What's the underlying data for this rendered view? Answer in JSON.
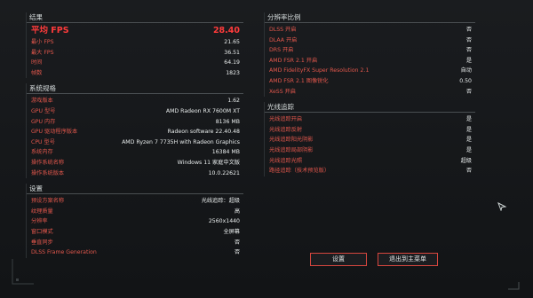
{
  "results": {
    "title": "结果",
    "avg_fps_label": "平均 FPS",
    "avg_fps": "28.40",
    "rows": [
      {
        "label": "最小 FPS",
        "value": "21.65"
      },
      {
        "label": "最大 FPS",
        "value": "36.51"
      },
      {
        "label": "时间",
        "value": "64.19"
      },
      {
        "label": "帧数",
        "value": "1823"
      }
    ]
  },
  "system": {
    "title": "系统规格",
    "rows": [
      {
        "label": "游戏版本",
        "value": "1.62"
      },
      {
        "label": "GPU 型号",
        "value": "AMD Radeon RX 7600M XT"
      },
      {
        "label": "GPU 内存",
        "value": "8136 MB"
      },
      {
        "label": "GPU 驱动程序版本",
        "value": "Radeon software 22.40.48"
      },
      {
        "label": "CPU 型号",
        "value": "AMD Ryzen 7 7735H with Radeon Graphics"
      },
      {
        "label": "系统内存",
        "value": "16384 MB"
      },
      {
        "label": "操作系统名称",
        "value": "Windows 11 家庭中文版"
      },
      {
        "label": "操作系统版本",
        "value": "10.0.22621"
      }
    ]
  },
  "settings": {
    "title": "设置",
    "rows": [
      {
        "label": "预设方案名称",
        "value": "光线追踪：超级"
      },
      {
        "label": "纹理质量",
        "value": "高"
      },
      {
        "label": "分辨率",
        "value": "2560x1440"
      },
      {
        "label": "窗口模式",
        "value": "全屏幕"
      },
      {
        "label": "垂直同步",
        "value": "否"
      },
      {
        "label": "DLSS Frame Generation",
        "value": "否"
      }
    ]
  },
  "resolution_scaling": {
    "title": "分辨率比例",
    "rows": [
      {
        "label": "DLSS 开启",
        "value": "否"
      },
      {
        "label": "DLAA 开启",
        "value": "否"
      },
      {
        "label": "DRS 开启",
        "value": "否"
      },
      {
        "label": "AMD FSR 2.1 开启",
        "value": "是"
      },
      {
        "label": "AMD FidelityFX Super Resolution 2.1",
        "value": "自动"
      },
      {
        "label": "AMD FSR 2.1 图像锐化",
        "value": "0.50"
      },
      {
        "label": "XeSS 开启",
        "value": "否"
      }
    ]
  },
  "ray_tracing": {
    "title": "光线追踪",
    "rows": [
      {
        "label": "光线追踪开启",
        "value": "是"
      },
      {
        "label": "光线追踪反射",
        "value": "是"
      },
      {
        "label": "光线追踪阳光阴影",
        "value": "是"
      },
      {
        "label": "光线追踪局部阴影",
        "value": "是"
      },
      {
        "label": "光线追踪光照",
        "value": "超级"
      },
      {
        "label": "路径追踪（技术预览版）",
        "value": "否"
      }
    ]
  },
  "buttons": {
    "settings": "设置",
    "exit": "退出到主菜单"
  },
  "colors": {
    "accent": "#e2574c",
    "highlight": "#ff3b3b",
    "value": "#e8ecec"
  }
}
